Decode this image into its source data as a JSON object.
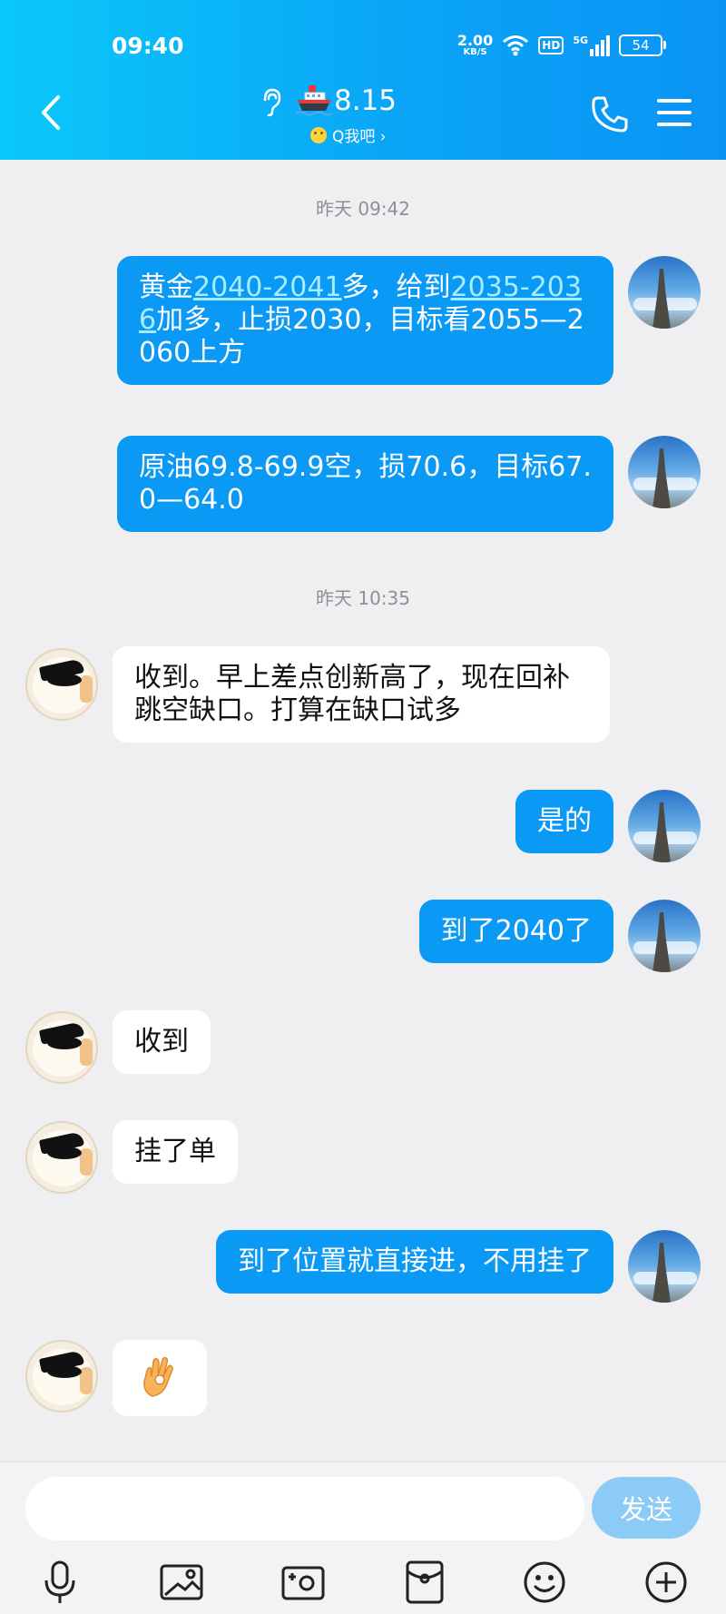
{
  "status": {
    "time": "09:40",
    "net_speed": "2.00",
    "net_unit": "KB/S",
    "hd": "HD",
    "signal": "5G",
    "battery": "54"
  },
  "header": {
    "title": "8.15",
    "subtitle": "Q我吧 ›"
  },
  "messages": {
    "ts1": "昨天 09:42",
    "m1": {
      "p1": "黄金",
      "link1": "2040-2041",
      "p2": "多，给到",
      "link2": "2035-2036",
      "p3": "加多，止损2030，目标看2055—2060上方"
    },
    "m2": "原油69.8-69.9空，损70.6，目标67.0—64.0",
    "ts2": "昨天 10:35",
    "m3": "收到。早上差点创新高了，现在回补跳空缺口。打算在缺口试多",
    "m4": "是的",
    "m5": "到了2040了",
    "m6": "收到",
    "m7": "挂了单",
    "m8": "到了位置就直接进，不用挂了",
    "m9_icon": "ok-hand-emoji"
  },
  "input": {
    "value": "",
    "send_label": "发送"
  },
  "toolbar_icons": [
    "microphone-icon",
    "image-icon",
    "camera-icon",
    "red-packet-icon",
    "emoji-icon",
    "plus-icon"
  ],
  "colors": {
    "header_start": "#0bc8fa",
    "header_end": "#0a93f5",
    "bubble_mine": "#0a99f5",
    "bubble_theirs": "#ffffff",
    "link": "#a8ecff",
    "send_button": "#8ccbf5"
  }
}
